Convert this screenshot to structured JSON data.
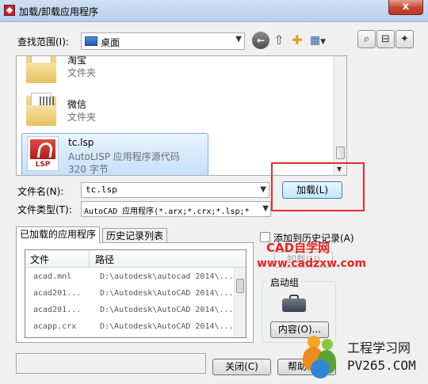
{
  "window": {
    "title": "加载/卸载应用程序",
    "close_glyph": "x"
  },
  "lookin": {
    "label": "查找范围(I):",
    "value": "桌面"
  },
  "files": [
    {
      "name": "淘宝",
      "type": "文件夹"
    },
    {
      "name": "微信",
      "type": "文件夹"
    },
    {
      "name": "tc.lsp",
      "type": "AutoLISP 应用程序源代码",
      "size": "320 字节"
    }
  ],
  "lsp_icon_text": "LSP",
  "filename": {
    "label": "文件名(N):",
    "value": "tc.lsp"
  },
  "filetype": {
    "label": "文件类型(T):",
    "value": "AutoCAD 应用程序(*.arx;*.crx;*.lsp;*"
  },
  "load_button": "加载(L)",
  "tabs": [
    "已加载的应用程序",
    "历史记录列表"
  ],
  "loaded_table": {
    "columns": [
      "文件",
      "路径"
    ],
    "rows": [
      [
        "acad.mnl",
        "D:\\autodesk\\autocad 2014\\..."
      ],
      [
        "acad201...",
        "D:\\Autodesk\\AutoCAD 2014\\..."
      ],
      [
        "acad201...",
        "D:\\Autodesk\\AutoCAD 2014\\..."
      ],
      [
        "acapp.crx",
        "D:\\Autodesk\\AutoCAD 2014\\..."
      ]
    ]
  },
  "add_to_history": {
    "label": "添加到历史记录(A)",
    "checked": false
  },
  "unload_button": "卸载(U)",
  "startup_group": {
    "title": "启动组",
    "contents_button": "内容(O)..."
  },
  "close_button": "关闭(C)",
  "help_button": "帮助",
  "watermark": {
    "line1": "CAD自学网",
    "line2": "www.cadzxw.com",
    "brand": "工程学习网",
    "brand_url": "PV265.COM"
  },
  "colors": {
    "accent_red": "#e62c2c",
    "selection": "#c4e0fb"
  }
}
